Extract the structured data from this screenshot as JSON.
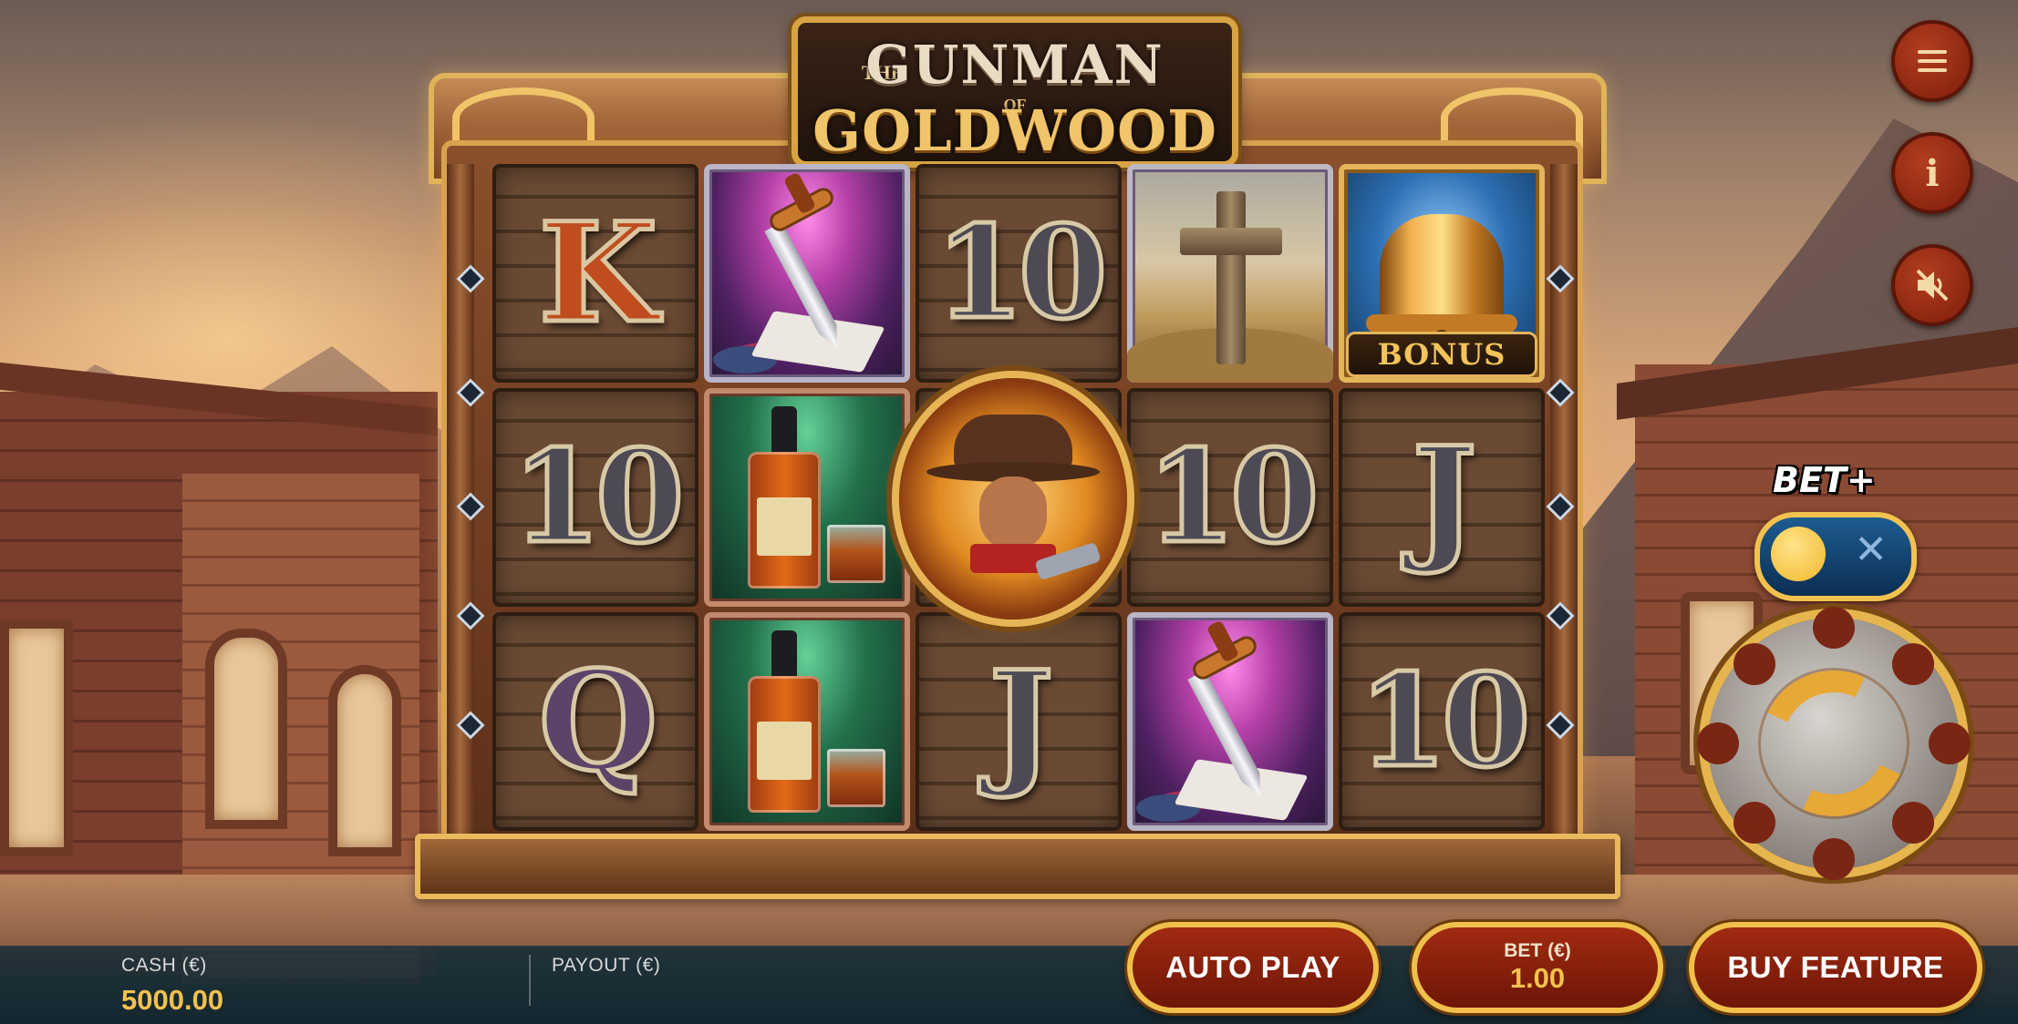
{
  "game": {
    "title_the": "THE",
    "title_main": "GUNMAN",
    "title_of": "OF",
    "title_sub": "GOLDWOOD"
  },
  "reels": {
    "rows": [
      [
        "K",
        "dagger",
        "10",
        "cross",
        "bonus-bell"
      ],
      [
        "10",
        "whiskey",
        "gunman-wild",
        "10",
        "J"
      ],
      [
        "Q",
        "whiskey",
        "J",
        "dagger",
        "10"
      ]
    ],
    "bonus_label": "BONUS"
  },
  "controls": {
    "menu_icon": "hamburger-menu-icon",
    "info_icon": "info-icon",
    "info_glyph": "i",
    "sound_icon": "sound-muted-icon",
    "bet_plus_label": "BET+",
    "bet_plus_toggle_glyph": "✕",
    "bet_plus_enabled": false,
    "spin_icon": "spin-refresh-icon"
  },
  "bottom_bar": {
    "cash_label": "CASH (€)",
    "cash_value": "5000.00",
    "payout_label": "PAYOUT (€)",
    "payout_value": "",
    "auto_play_label": "AUTO PLAY",
    "bet_label": "BET (€)",
    "bet_value": "1.00",
    "buy_feature_label": "BUY FEATURE"
  },
  "colors": {
    "accent_gold": "#f2c14e",
    "button_red": "#a12a12",
    "toggle_blue": "#1d5b8f"
  }
}
